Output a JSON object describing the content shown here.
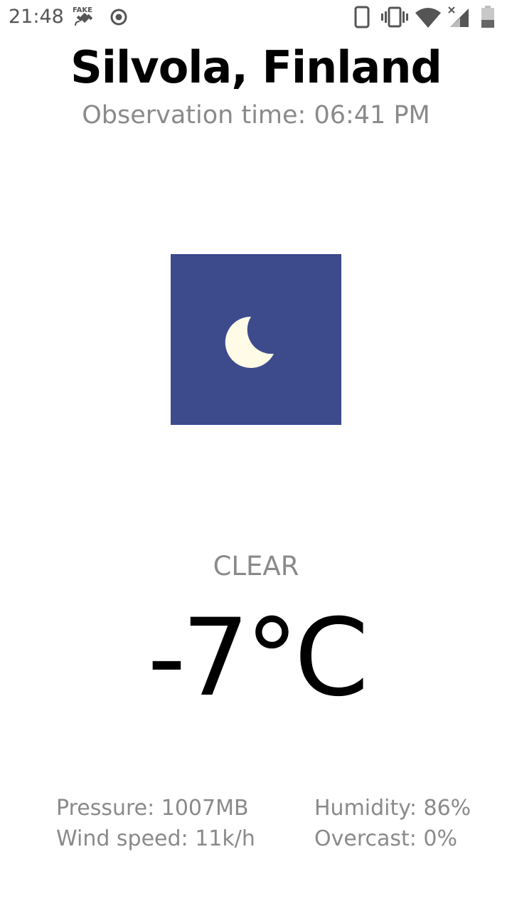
{
  "status_bar": {
    "time": "21:48",
    "icons": [
      "fake-gps-icon",
      "record-icon",
      "phone-icon",
      "vibrate-icon",
      "wifi-icon",
      "signal-icon",
      "battery-icon"
    ],
    "icon_color": "#555555",
    "fake_gps_label": "FAKE"
  },
  "header": {
    "location": "Silvola, Finland",
    "observation_time": "Observation time: 06:41 PM"
  },
  "weather": {
    "icon": "moon-icon",
    "icon_bg": "#3d4b8d",
    "moon_color": "#fffbe6",
    "condition": "CLEAR",
    "temperature": "-7°C"
  },
  "details": {
    "pressure": "Pressure: 1007MB",
    "humidity": "Humidity: 86%",
    "wind_speed": "Wind speed: 11k/h",
    "overcast": "Overcast: 0%"
  }
}
